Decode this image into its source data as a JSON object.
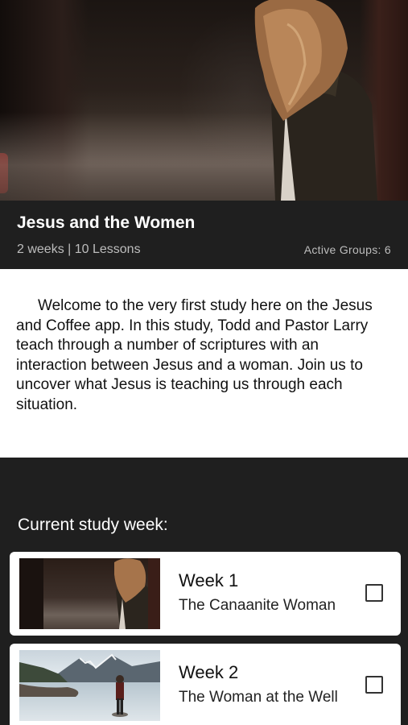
{
  "study": {
    "title": "Jesus and the Women",
    "meta": "2 weeks | 10 Lessons",
    "active_groups": "Active Groups: 6"
  },
  "description": "Welcome to the very first study here on the Jesus and Coffee app.  In this study, Todd and Pastor Larry teach through a number of scriptures with an interaction between Jesus and a woman.  Join us to uncover what Jesus is teaching us through each situation.",
  "current_week": {
    "heading": "Current study week:"
  },
  "weeks": [
    {
      "label": "Week 1",
      "subtitle": "The Canaanite Woman",
      "checked": false
    },
    {
      "label": "Week 2",
      "subtitle": "The Woman at the Well",
      "checked": false
    }
  ],
  "colors": {
    "dark_bg": "#1f1f1f",
    "card_bg": "#ffffff",
    "meta_text": "#bdbdbd"
  }
}
